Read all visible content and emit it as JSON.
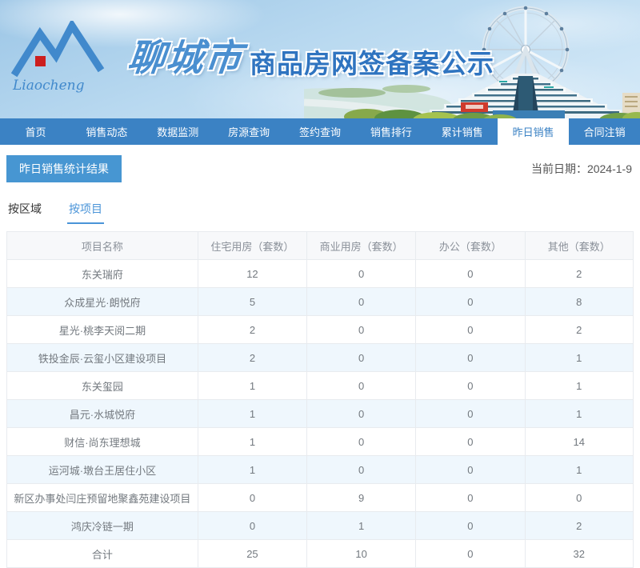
{
  "colors": {
    "nav_blue": "#3b82c4",
    "badge_blue": "#4796d2",
    "title_blue": "#2f74c0",
    "zebra_row": "#eff7fd",
    "logo_red": "#cc1f1f"
  },
  "header": {
    "logo_script": "Liaocheng",
    "city_name": "聊城市",
    "site_title": "商品房网签备案公示"
  },
  "nav": {
    "items": [
      {
        "id": "home",
        "label": "首页",
        "active": false
      },
      {
        "id": "sales-dynamics",
        "label": "销售动态",
        "active": false
      },
      {
        "id": "data-monitoring",
        "label": "数据监测",
        "active": false
      },
      {
        "id": "listing-query",
        "label": "房源查询",
        "active": false
      },
      {
        "id": "contract-query",
        "label": "签约查询",
        "active": false
      },
      {
        "id": "sales-ranking",
        "label": "销售排行",
        "active": false
      },
      {
        "id": "cumulative-sales",
        "label": "累计销售",
        "active": false
      },
      {
        "id": "yesterday-sales",
        "label": "昨日销售",
        "active": true
      },
      {
        "id": "contract-cancellation",
        "label": "合同注销",
        "active": false
      }
    ]
  },
  "page": {
    "section_title": "昨日销售统计结果",
    "current_date": "当前日期：2024-1-9"
  },
  "tabs": [
    {
      "id": "by-region",
      "label": "按区域",
      "active": false
    },
    {
      "id": "by-project",
      "label": "按项目",
      "active": true
    }
  ],
  "table": {
    "columns": [
      "项目名称",
      "住宅用房（套数）",
      "商业用房（套数）",
      "办公（套数）",
      "其他（套数）"
    ],
    "rows": [
      [
        "东关瑞府",
        "12",
        "0",
        "0",
        "2"
      ],
      [
        "众成星光·朗悦府",
        "5",
        "0",
        "0",
        "8"
      ],
      [
        "星光·桃李天阅二期",
        "2",
        "0",
        "0",
        "2"
      ],
      [
        "铁投金辰·云玺小区建设项目",
        "2",
        "0",
        "0",
        "1"
      ],
      [
        "东关玺园",
        "1",
        "0",
        "0",
        "1"
      ],
      [
        "昌元·水城悦府",
        "1",
        "0",
        "0",
        "1"
      ],
      [
        "财信·尚东理想城",
        "1",
        "0",
        "0",
        "14"
      ],
      [
        "运河城·墩台王居住小区",
        "1",
        "0",
        "0",
        "1"
      ],
      [
        "新区办事处闫庄预留地聚鑫苑建设项目",
        "0",
        "9",
        "0",
        "0"
      ],
      [
        "鸿庆冷链一期",
        "0",
        "1",
        "0",
        "2"
      ]
    ],
    "total_row": [
      "合计",
      "25",
      "10",
      "0",
      "32"
    ]
  }
}
